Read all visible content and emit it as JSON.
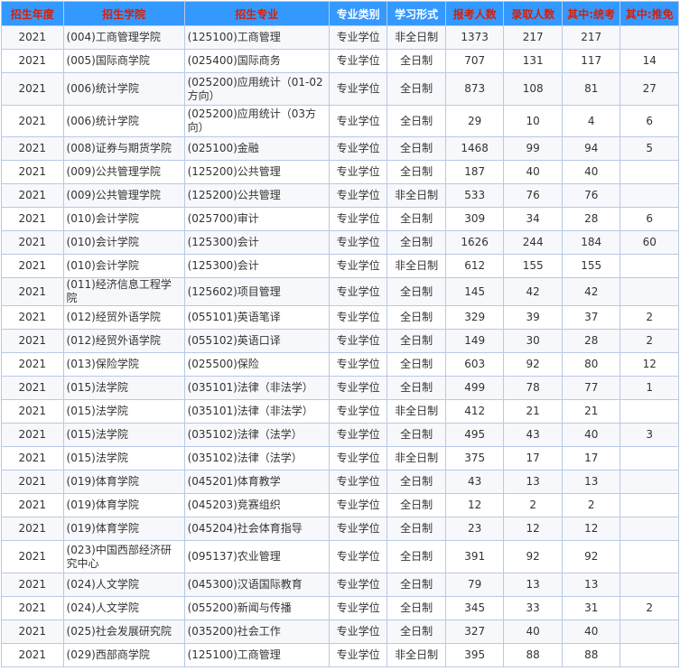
{
  "header": {
    "bg_color": "#3399ff",
    "red_color": "#d81e06",
    "white_color": "#ffffff",
    "columns": [
      {
        "label": "招生年度",
        "color": "red"
      },
      {
        "label": "招生学院",
        "color": "red"
      },
      {
        "label": "招生专业",
        "color": "red"
      },
      {
        "label": "专业类别",
        "color": "white"
      },
      {
        "label": "学习形式",
        "color": "white"
      },
      {
        "label": "报考人数",
        "color": "red"
      },
      {
        "label": "录取人数",
        "color": "red"
      },
      {
        "label": "其中:统考",
        "color": "red"
      },
      {
        "label": "其中:推免",
        "color": "red"
      }
    ]
  },
  "rows": [
    {
      "year": "2021",
      "college": "(004)工商管理学院",
      "major": "(125100)工商管理",
      "category": "专业学位",
      "mode": "非全日制",
      "applicants": "1373",
      "admitted": "217",
      "exam": "217",
      "exempt": ""
    },
    {
      "year": "2021",
      "college": "(005)国际商学院",
      "major": "(025400)国际商务",
      "category": "专业学位",
      "mode": "全日制",
      "applicants": "707",
      "admitted": "131",
      "exam": "117",
      "exempt": "14"
    },
    {
      "year": "2021",
      "college": "(006)统计学院",
      "major": "(025200)应用统计（01-02方向）",
      "category": "专业学位",
      "mode": "全日制",
      "applicants": "873",
      "admitted": "108",
      "exam": "81",
      "exempt": "27"
    },
    {
      "year": "2021",
      "college": "(006)统计学院",
      "major": "(025200)应用统计（03方向）",
      "category": "专业学位",
      "mode": "全日制",
      "applicants": "29",
      "admitted": "10",
      "exam": "4",
      "exempt": "6"
    },
    {
      "year": "2021",
      "college": "(008)证券与期货学院",
      "major": "(025100)金融",
      "category": "专业学位",
      "mode": "全日制",
      "applicants": "1468",
      "admitted": "99",
      "exam": "94",
      "exempt": "5"
    },
    {
      "year": "2021",
      "college": "(009)公共管理学院",
      "major": "(125200)公共管理",
      "category": "专业学位",
      "mode": "全日制",
      "applicants": "187",
      "admitted": "40",
      "exam": "40",
      "exempt": ""
    },
    {
      "year": "2021",
      "college": "(009)公共管理学院",
      "major": "(125200)公共管理",
      "category": "专业学位",
      "mode": "非全日制",
      "applicants": "533",
      "admitted": "76",
      "exam": "76",
      "exempt": ""
    },
    {
      "year": "2021",
      "college": "(010)会计学院",
      "major": "(025700)审计",
      "category": "专业学位",
      "mode": "全日制",
      "applicants": "309",
      "admitted": "34",
      "exam": "28",
      "exempt": "6"
    },
    {
      "year": "2021",
      "college": "(010)会计学院",
      "major": "(125300)会计",
      "category": "专业学位",
      "mode": "全日制",
      "applicants": "1626",
      "admitted": "244",
      "exam": "184",
      "exempt": "60"
    },
    {
      "year": "2021",
      "college": "(010)会计学院",
      "major": "(125300)会计",
      "category": "专业学位",
      "mode": "非全日制",
      "applicants": "612",
      "admitted": "155",
      "exam": "155",
      "exempt": ""
    },
    {
      "year": "2021",
      "college": "(011)经济信息工程学院",
      "major": "(125602)项目管理",
      "category": "专业学位",
      "mode": "全日制",
      "applicants": "145",
      "admitted": "42",
      "exam": "42",
      "exempt": ""
    },
    {
      "year": "2021",
      "college": "(012)经贸外语学院",
      "major": "(055101)英语笔译",
      "category": "专业学位",
      "mode": "全日制",
      "applicants": "329",
      "admitted": "39",
      "exam": "37",
      "exempt": "2"
    },
    {
      "year": "2021",
      "college": "(012)经贸外语学院",
      "major": "(055102)英语口译",
      "category": "专业学位",
      "mode": "全日制",
      "applicants": "149",
      "admitted": "30",
      "exam": "28",
      "exempt": "2"
    },
    {
      "year": "2021",
      "college": "(013)保险学院",
      "major": "(025500)保险",
      "category": "专业学位",
      "mode": "全日制",
      "applicants": "603",
      "admitted": "92",
      "exam": "80",
      "exempt": "12"
    },
    {
      "year": "2021",
      "college": "(015)法学院",
      "major": "(035101)法律（非法学）",
      "category": "专业学位",
      "mode": "全日制",
      "applicants": "499",
      "admitted": "78",
      "exam": "77",
      "exempt": "1"
    },
    {
      "year": "2021",
      "college": "(015)法学院",
      "major": "(035101)法律（非法学）",
      "category": "专业学位",
      "mode": "非全日制",
      "applicants": "412",
      "admitted": "21",
      "exam": "21",
      "exempt": ""
    },
    {
      "year": "2021",
      "college": "(015)法学院",
      "major": "(035102)法律（法学）",
      "category": "专业学位",
      "mode": "全日制",
      "applicants": "495",
      "admitted": "43",
      "exam": "40",
      "exempt": "3"
    },
    {
      "year": "2021",
      "college": "(015)法学院",
      "major": "(035102)法律（法学）",
      "category": "专业学位",
      "mode": "非全日制",
      "applicants": "375",
      "admitted": "17",
      "exam": "17",
      "exempt": ""
    },
    {
      "year": "2021",
      "college": "(019)体育学院",
      "major": "(045201)体育教学",
      "category": "专业学位",
      "mode": "全日制",
      "applicants": "43",
      "admitted": "13",
      "exam": "13",
      "exempt": ""
    },
    {
      "year": "2021",
      "college": "(019)体育学院",
      "major": "(045203)竞赛组织",
      "category": "专业学位",
      "mode": "全日制",
      "applicants": "12",
      "admitted": "2",
      "exam": "2",
      "exempt": ""
    },
    {
      "year": "2021",
      "college": "(019)体育学院",
      "major": "(045204)社会体育指导",
      "category": "专业学位",
      "mode": "全日制",
      "applicants": "23",
      "admitted": "12",
      "exam": "12",
      "exempt": ""
    },
    {
      "year": "2021",
      "college": "(023)中国西部经济研究中心",
      "major": "(095137)农业管理",
      "category": "专业学位",
      "mode": "全日制",
      "applicants": "391",
      "admitted": "92",
      "exam": "92",
      "exempt": ""
    },
    {
      "year": "2021",
      "college": "(024)人文学院",
      "major": "(045300)汉语国际教育",
      "category": "专业学位",
      "mode": "全日制",
      "applicants": "79",
      "admitted": "13",
      "exam": "13",
      "exempt": ""
    },
    {
      "year": "2021",
      "college": "(024)人文学院",
      "major": "(055200)新闻与传播",
      "category": "专业学位",
      "mode": "全日制",
      "applicants": "345",
      "admitted": "33",
      "exam": "31",
      "exempt": "2"
    },
    {
      "year": "2021",
      "college": "(025)社会发展研究院",
      "major": "(035200)社会工作",
      "category": "专业学位",
      "mode": "全日制",
      "applicants": "327",
      "admitted": "40",
      "exam": "40",
      "exempt": ""
    },
    {
      "year": "2021",
      "college": "(029)西部商学院",
      "major": "(125100)工商管理",
      "category": "专业学位",
      "mode": "非全日制",
      "applicants": "395",
      "admitted": "88",
      "exam": "88",
      "exempt": ""
    }
  ]
}
